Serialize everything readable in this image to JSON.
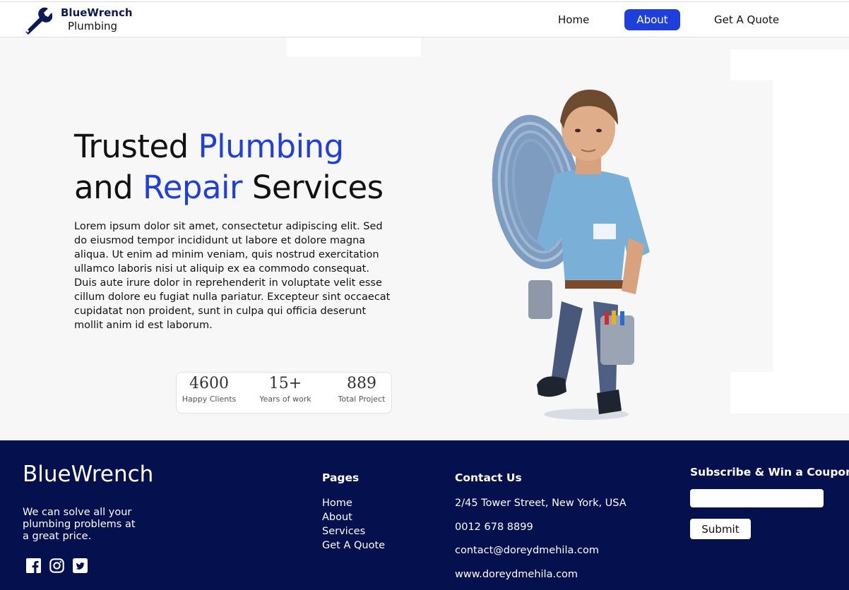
{
  "header": {
    "brand_name": "BlueWrench",
    "brand_sub": "Plumbing",
    "nav": {
      "home": "Home",
      "about": "About",
      "quote": "Get A Quote"
    },
    "active_color": "#1f3fdd"
  },
  "hero": {
    "headline": {
      "w1": "Trusted ",
      "w2": "Plumbing",
      "w3": "and ",
      "w4": "Repair",
      "w5": " Services"
    },
    "paragraph": "Lorem ipsum dolor sit amet, consectetur adipiscing elit. Sed do eiusmod tempor incididunt ut labore et dolore magna aliqua. Ut enim ad minim veniam, quis nostrud exercitation ullamco laboris nisi ut aliquip ex ea commodo consequat. Duis aute irure dolor in reprehenderit in voluptate velit esse cillum dolore eu fugiat nulla pariatur. Excepteur sint occaecat cupidatat non proident, sunt in culpa qui officia deserunt mollit anim id est laborum.",
    "stats": [
      {
        "value": "4600",
        "label": "Happy Clients"
      },
      {
        "value": "15+",
        "label": "Years of work"
      },
      {
        "value": "889",
        "label": "Total Project"
      }
    ]
  },
  "footer": {
    "brand": "BlueWrench",
    "tagline": "We can solve all your plumbing problems at a great price.",
    "socials": [
      "facebook-icon",
      "instagram-icon",
      "twitter-icon"
    ],
    "pages_title": "Pages",
    "pages": [
      "Home",
      "About",
      "Services",
      "Get A Quote"
    ],
    "contact_title": "Contact Us",
    "contact": {
      "address": "2/45 Tower Street, New York, USA",
      "phone": "0012 678 8899",
      "email": "contact@doreydmehila.com",
      "website": "www.doreydmehila.com"
    },
    "subscribe_title": "Subscribe & Win a Coupon",
    "subscribe_placeholder": "",
    "submit_label": "Submit",
    "background": "#05104f"
  }
}
